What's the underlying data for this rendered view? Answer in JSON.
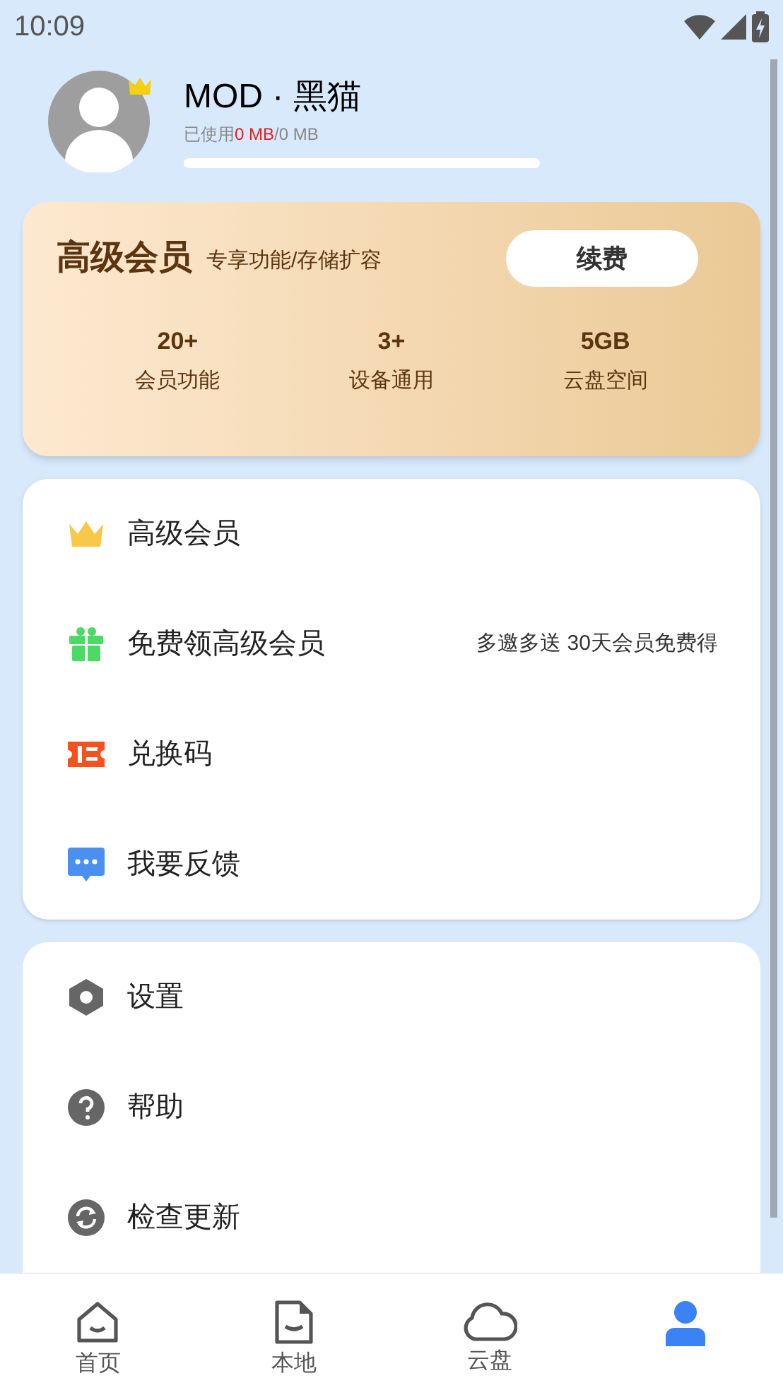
{
  "status_bar": {
    "time": "10:09"
  },
  "profile": {
    "name": "MOD · 黑猫",
    "usage_label": "已使用",
    "usage_used": "0 MB",
    "usage_total": "/0 MB"
  },
  "vip_card": {
    "title": "高级会员",
    "subtitle": "专享功能/存储扩容",
    "button": "续费",
    "stats": [
      {
        "value": "20+",
        "label": "会员功能"
      },
      {
        "value": "3+",
        "label": "设备通用"
      },
      {
        "value": "5GB",
        "label": "云盘空间"
      }
    ]
  },
  "menu": [
    {
      "kind": "crown",
      "label": "高级会员"
    },
    {
      "kind": "gift",
      "label": "免费领高级会员",
      "note": "多邀多送 30天会员免费得"
    },
    {
      "kind": "ticket",
      "label": "兑换码"
    },
    {
      "kind": "chat",
      "label": "我要反馈"
    }
  ],
  "settings": [
    {
      "kind": "gear",
      "label": "设置"
    },
    {
      "kind": "help",
      "label": "帮助"
    },
    {
      "kind": "refresh",
      "label": "检查更新"
    }
  ],
  "tabs": [
    {
      "kind": "home",
      "label": "首页",
      "selected": false
    },
    {
      "kind": "file",
      "label": "本地",
      "selected": false
    },
    {
      "kind": "cloud",
      "label": "云盘",
      "selected": false
    },
    {
      "kind": "user",
      "selected": true
    }
  ]
}
